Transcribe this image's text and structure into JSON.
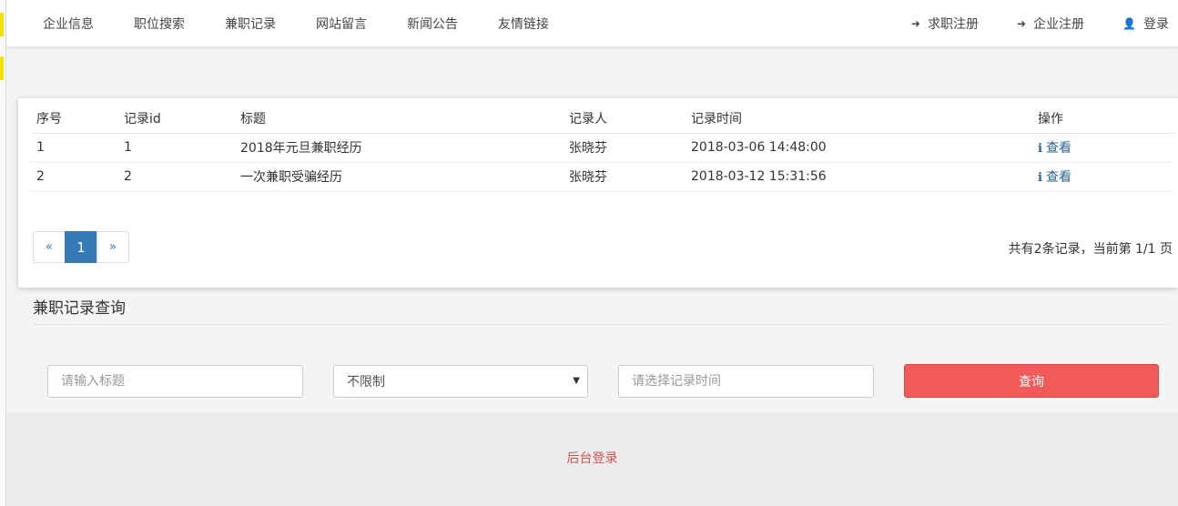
{
  "nav": {
    "left": [
      "企业信息",
      "职位搜索",
      "兼职记录",
      "网站留言",
      "新闻公告",
      "友情链接"
    ],
    "right": [
      {
        "icon": "sign-in-icon",
        "glyph": "➜",
        "label": "求职注册"
      },
      {
        "icon": "sign-in-icon",
        "glyph": "➜",
        "label": "企业注册"
      },
      {
        "icon": "user-icon",
        "glyph": "👤",
        "label": "登录"
      }
    ]
  },
  "table": {
    "headers": [
      "序号",
      "记录id",
      "标题",
      "记录人",
      "记录时间",
      "操作"
    ],
    "rows": [
      {
        "seq": "1",
        "id": "1",
        "title": "2018年元旦兼职经历",
        "recorder": "张晓芬",
        "time": "2018-03-06 14:48:00",
        "action": "查看"
      },
      {
        "seq": "2",
        "id": "2",
        "title": "一次兼职受骗经历",
        "recorder": "张晓芬",
        "time": "2018-03-12 15:31:56",
        "action": "查看"
      }
    ]
  },
  "pager": {
    "prev": "«",
    "current": "1",
    "next": "»",
    "info": "共有2条记录，当前第 1/1 页"
  },
  "search": {
    "section_title": "兼职记录查询",
    "title_placeholder": "请输入标题",
    "select_value": "不限制",
    "time_placeholder": "请选择记录时间",
    "query_label": "查询"
  },
  "footer": {
    "admin_login": "后台登录"
  },
  "colors": {
    "primary": "#337ab7",
    "query_button": "#f25a5a",
    "footer_link": "#d9534f"
  }
}
